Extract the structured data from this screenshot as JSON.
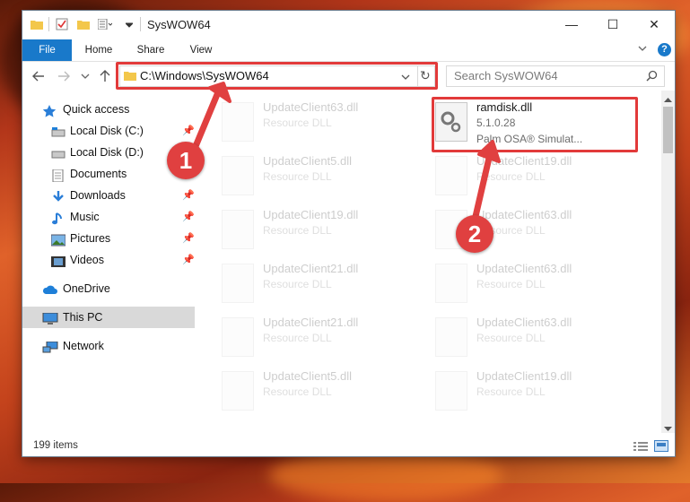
{
  "window": {
    "title": "SysWOW64",
    "controls": {
      "minimize": "—",
      "maximize": "☐",
      "close": "✕"
    }
  },
  "ribbon": {
    "tabs": [
      "File",
      "Home",
      "Share",
      "View"
    ]
  },
  "navigation": {
    "address": "C:\\Windows\\SysWOW64",
    "search_placeholder": "Search SysWOW64"
  },
  "sidebar": {
    "items": [
      {
        "label": "Quick access",
        "icon": "star-icon"
      },
      {
        "label": "Local Disk (C:)",
        "icon": "drive-icon"
      },
      {
        "label": "Local Disk (D:)",
        "icon": "drive-icon"
      },
      {
        "label": "Documents",
        "icon": "documents-icon"
      },
      {
        "label": "Downloads",
        "icon": "downloads-icon"
      },
      {
        "label": "Music",
        "icon": "music-icon"
      },
      {
        "label": "Pictures",
        "icon": "pictures-icon"
      },
      {
        "label": "Videos",
        "icon": "videos-icon"
      },
      {
        "label": "OneDrive",
        "icon": "cloud-icon"
      },
      {
        "label": "This PC",
        "icon": "computer-icon"
      },
      {
        "label": "Network",
        "icon": "network-icon"
      }
    ]
  },
  "files": {
    "highlighted": {
      "name": "ramdisk.dll",
      "version": "5.1.0.28",
      "company": "Palm OSA® Simulat..."
    },
    "left_column": [
      {
        "name": "UpdateClient63.dll",
        "desc": "Resource DLL"
      },
      {
        "name": "UpdateClient5.dll",
        "desc": "Resource DLL"
      },
      {
        "name": "UpdateClient19.dll",
        "desc": "Resource DLL"
      },
      {
        "name": "UpdateClient21.dll",
        "desc": "Resource DLL"
      },
      {
        "name": "UpdateClient21.dll",
        "desc": "Resource DLL"
      },
      {
        "name": "UpdateClient5.dll",
        "desc": "Resource DLL"
      }
    ],
    "right_column": [
      {
        "name": "UpdateClient19.dll",
        "desc": "Resource DLL"
      },
      {
        "name": "UpdateClient63.dll",
        "desc": "Resource DLL"
      },
      {
        "name": "UpdateClient63.dll",
        "desc": "Resource DLL"
      },
      {
        "name": "UpdateClient63.dll",
        "desc": "Resource DLL"
      },
      {
        "name": "UpdateClient19.dll",
        "desc": "Resource DLL"
      }
    ]
  },
  "status": {
    "item_count": "199 items"
  },
  "annotations": {
    "badge1": "1",
    "badge2": "2"
  },
  "colors": {
    "accent": "#1979ca",
    "highlight": "#e23a3a",
    "badge": "#e04040"
  }
}
